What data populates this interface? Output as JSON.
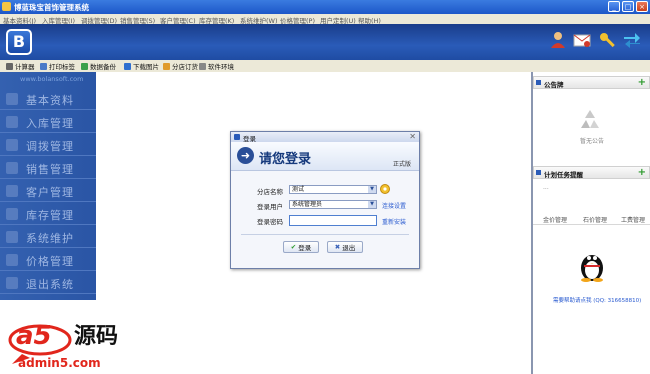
{
  "window": {
    "title": "博蓝珠宝首饰管理系统",
    "controls": [
      "_",
      "□",
      "×"
    ]
  },
  "menu": [
    "基本资料(J)",
    "入库管理(I)",
    "调拨管理(D)",
    "销售管理(S)",
    "客户管理(C)",
    "库存管理(K)",
    "系统维护(W)",
    "价格管理(P)",
    "用户定制(U)",
    "帮助(H)"
  ],
  "header": {
    "logo_letter": "B"
  },
  "toolbar": [
    "计算器",
    "打印标签",
    "数据备份",
    "下载图片",
    "分店订货",
    "软件环境"
  ],
  "nav": {
    "url": "www.bolansoft.com",
    "items": [
      "基本资料",
      "入库管理",
      "调拨管理",
      "销售管理",
      "客户管理",
      "库存管理",
      "系统维护",
      "价格管理",
      "退出系统"
    ]
  },
  "right": {
    "notice_title": "公告牌",
    "notice_empty": "暂无公告",
    "task_title": "计划任务提醒",
    "task_dots": "...",
    "tabs": [
      "金价管理",
      "石价管理",
      "工费管理"
    ],
    "qq_link": "需要帮助请点我 (QQ: 316658810)"
  },
  "dialog": {
    "title": "登录",
    "heading": "请您登录",
    "edition": "正式版",
    "store_label": "分店名称",
    "store_value": "测试",
    "user_label": "登录用户",
    "user_value": "系统管理员",
    "pwd_label": "登录密码",
    "pwd_value": "",
    "conn_link": "连接设置",
    "reinstall_link": "重新安装",
    "login_btn": "登录",
    "exit_btn": "退出"
  },
  "watermark": {
    "brand_left": "a5",
    "brand_right": "源码",
    "site": "admin5.com"
  },
  "colors": {
    "nav_bg": "#2a55a5",
    "header_bg": "#1f4ca3",
    "link": "#2a5bd0",
    "watermark_red": "#e1261c"
  }
}
